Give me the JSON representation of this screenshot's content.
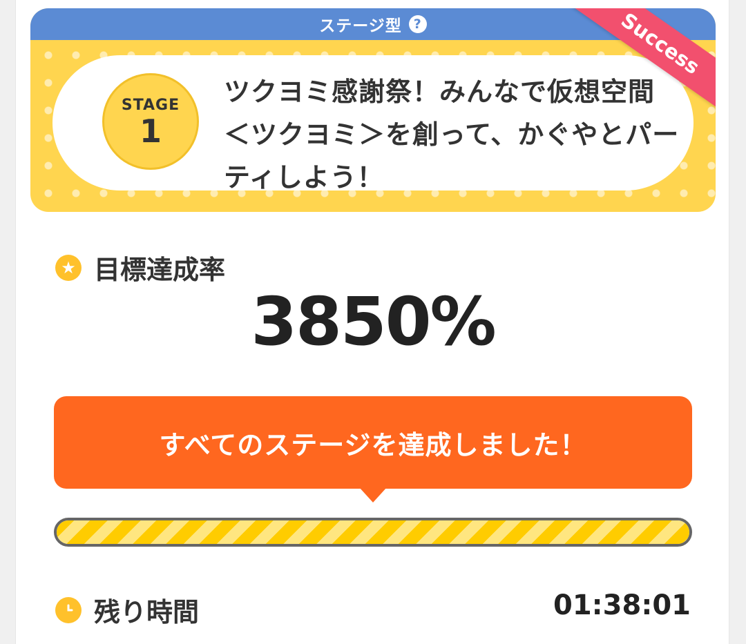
{
  "stage": {
    "type_label": "ステージ型",
    "help_icon": "question-circle-icon",
    "badge_label": "STAGE",
    "badge_number": "1",
    "title": "ツクヨミ感謝祭！みんなで仮想空間＜ツクヨミ＞を創って、かぐやとパーティしよう！",
    "ribbon": "Success"
  },
  "goal": {
    "icon": "star-icon",
    "label": "目標達成率",
    "value": "3850%"
  },
  "banner": {
    "text": "すべてのステージを達成しました！"
  },
  "progress": {
    "fraction": 1.0
  },
  "remaining": {
    "icon": "clock-icon",
    "label": "残り時間",
    "value": "01:38:01"
  },
  "colors": {
    "header_blue": "#5b8bd4",
    "stage_yellow": "#ffd54f",
    "ribbon_pink": "#f2506e",
    "banner_orange": "#ff671f",
    "icon_gold": "#ffc12b"
  }
}
